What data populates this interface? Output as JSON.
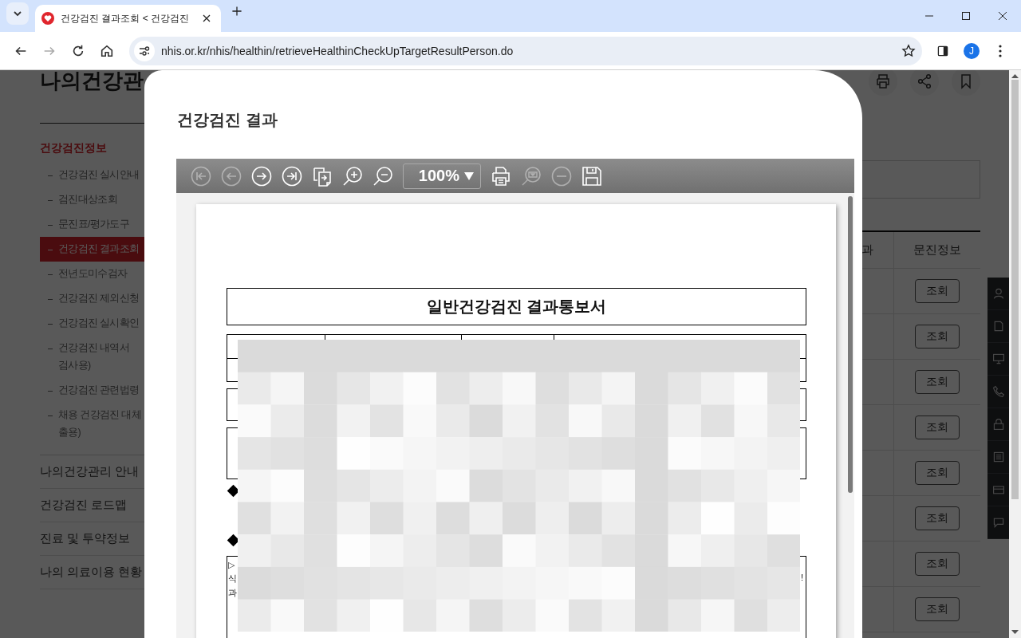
{
  "browser": {
    "tab": {
      "title": "건강검진 결과조회 < 건강검진",
      "selected": true
    },
    "url": "nhis.or.kr/nhis/healthin/retrieveHealthinCheckUpTargetResultPerson.do",
    "forward_disabled": true,
    "profile_initial": "J"
  },
  "page": {
    "title": "나의건강관",
    "section": "건강검진정보",
    "sub_items": [
      {
        "lines": [
          "건강검진 실시안내"
        ],
        "selected": false
      },
      {
        "lines": [
          "검진대상조회"
        ],
        "selected": false
      },
      {
        "lines": [
          "문진표/평가도구"
        ],
        "selected": false
      },
      {
        "lines": [
          "건강검진 결과조회"
        ],
        "selected": true
      },
      {
        "lines": [
          "전년도미수검자"
        ],
        "selected": false
      },
      {
        "lines": [
          "건강검진 제외신청"
        ],
        "selected": false
      },
      {
        "lines": [
          "건강검진 실시확인"
        ],
        "selected": false
      },
      {
        "lines": [
          "건강검진 내역서",
          "검사용)"
        ],
        "selected": false
      },
      {
        "lines": [
          "건강검진 관련법령"
        ],
        "selected": false
      },
      {
        "lines": [
          "채용 건강검진 대체",
          "출용)"
        ],
        "selected": false
      }
    ],
    "menu": [
      "나의건강관리 안내",
      "건강검진 로드맵",
      "진료 및 투약정보",
      "나의 의료이용 현황"
    ],
    "table": {
      "columns": [
        "과",
        "문진정보"
      ],
      "rows": [
        {
          "button": "조회"
        },
        {
          "button": "조회"
        },
        {
          "button": "조회"
        },
        {
          "button": "조회"
        },
        {
          "button": "조회"
        },
        {
          "button": "조회"
        },
        {
          "button": "조회"
        },
        {
          "button": "조회"
        }
      ]
    }
  },
  "modal": {
    "title": "건강검진 결과",
    "viewer": {
      "tools": [
        {
          "kind": "first",
          "disabled": true
        },
        {
          "kind": "prev",
          "disabled": true
        },
        {
          "kind": "next",
          "disabled": false
        },
        {
          "kind": "last",
          "disabled": false
        },
        {
          "kind": "export",
          "disabled": false
        },
        {
          "kind": "zoom-in",
          "disabled": false
        },
        {
          "kind": "zoom-out",
          "disabled": false
        },
        {
          "kind": "zoom-select",
          "value": "100%",
          "disabled": false
        },
        {
          "kind": "print",
          "disabled": false
        },
        {
          "kind": "find",
          "disabled": true
        },
        {
          "kind": "minus",
          "disabled": true
        },
        {
          "kind": "save",
          "disabled": false
        }
      ],
      "document": {
        "title": "일반건강검진 결과통보서",
        "box_mark": "▷",
        "line_start": "식",
        "line_end": "!",
        "line2_start": "과"
      }
    }
  }
}
